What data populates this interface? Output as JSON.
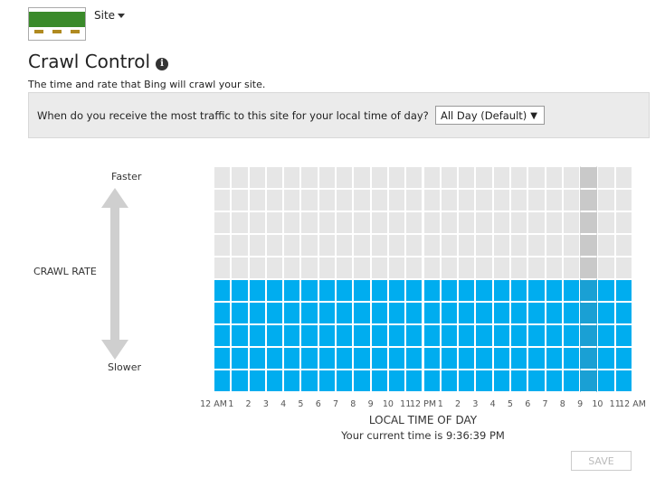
{
  "header": {
    "site_label": "Site",
    "title": "Crawl Control",
    "description": "The time and rate that Bing will crawl your site."
  },
  "traffic": {
    "question": "When do you receive the most traffic to this site for your local time of day?",
    "selected": "All Day (Default)"
  },
  "chart": {
    "faster": "Faster",
    "slower": "Slower",
    "y_label": "CRAWL RATE",
    "x_label": "LOCAL TIME OF DAY",
    "current_time": "Your current time is 9:36:39 PM"
  },
  "chart_data": {
    "type": "heatmap",
    "xlabel": "LOCAL TIME OF DAY",
    "ylabel": "CRAWL RATE",
    "tick_labels": [
      "12 AM",
      "1",
      "2",
      "3",
      "4",
      "5",
      "6",
      "7",
      "8",
      "9",
      "10",
      "11",
      "12 PM",
      "1",
      "2",
      "3",
      "4",
      "5",
      "6",
      "7",
      "8",
      "9",
      "10",
      "11",
      "12 AM"
    ],
    "levels": 10,
    "values": [
      5,
      5,
      5,
      5,
      5,
      5,
      5,
      5,
      5,
      5,
      5,
      5,
      5,
      5,
      5,
      5,
      5,
      5,
      5,
      5,
      5,
      5,
      5,
      5
    ],
    "current_hour_index": 21,
    "colors": {
      "filled": "#00adef",
      "empty": "#e6e6e6",
      "current_filled": "#1aa0d4",
      "current_empty": "#c9c9c9"
    }
  },
  "save_label": "SAVE"
}
